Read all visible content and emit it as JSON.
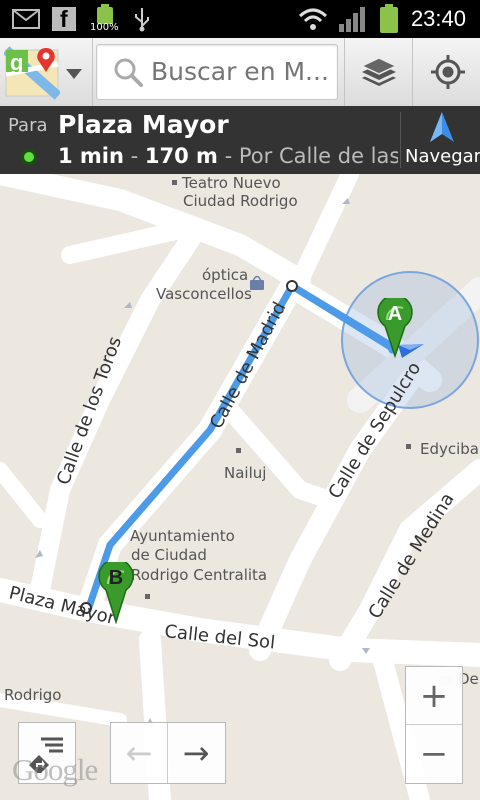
{
  "status_bar": {
    "time": "23:40",
    "battery_label": "100%"
  },
  "toolbar": {
    "search_placeholder": "Buscar en M..."
  },
  "route": {
    "to_label": "Para",
    "destination": "Plaza Mayor",
    "duration": "1 min",
    "distance": "170 m",
    "dash": "-",
    "via": "Por Calle de las ...",
    "navigate_label": "Navegar"
  },
  "map": {
    "streets": {
      "calle_de_madrid": "Calle de Madrid",
      "calle_de_los_toros": "Calle de los Toros",
      "calle_de_sepulcro": "Calle de Sepulcro",
      "calle_de_medina": "Calle de Medina",
      "calle_del_sol": "Calle del Sol",
      "plaza_mayor": "Plaza Mayor"
    },
    "pois": {
      "teatro_line1": "Teatro Nuevo",
      "teatro_line2": "Ciudad Rodrigo",
      "optica_line1": "óptica",
      "optica_line2": "Vasconcellos",
      "edyciba": "Edyciba",
      "nailuj": "Nailuj",
      "ayto_line1": "Ayuntamiento",
      "ayto_line2": "de Ciudad",
      "ayto_line3": "Rodrigo Centralita",
      "rodrigo": "Rodrigo",
      "dep": "Dep"
    },
    "markers": {
      "start": "A",
      "end": "B"
    },
    "route_color": "#4d9be8",
    "marker_color": "#3a9a2c"
  },
  "controls": {
    "zoom_in": "+",
    "zoom_out": "−",
    "prev_step": "←",
    "next_step": "→",
    "google": "Google"
  }
}
